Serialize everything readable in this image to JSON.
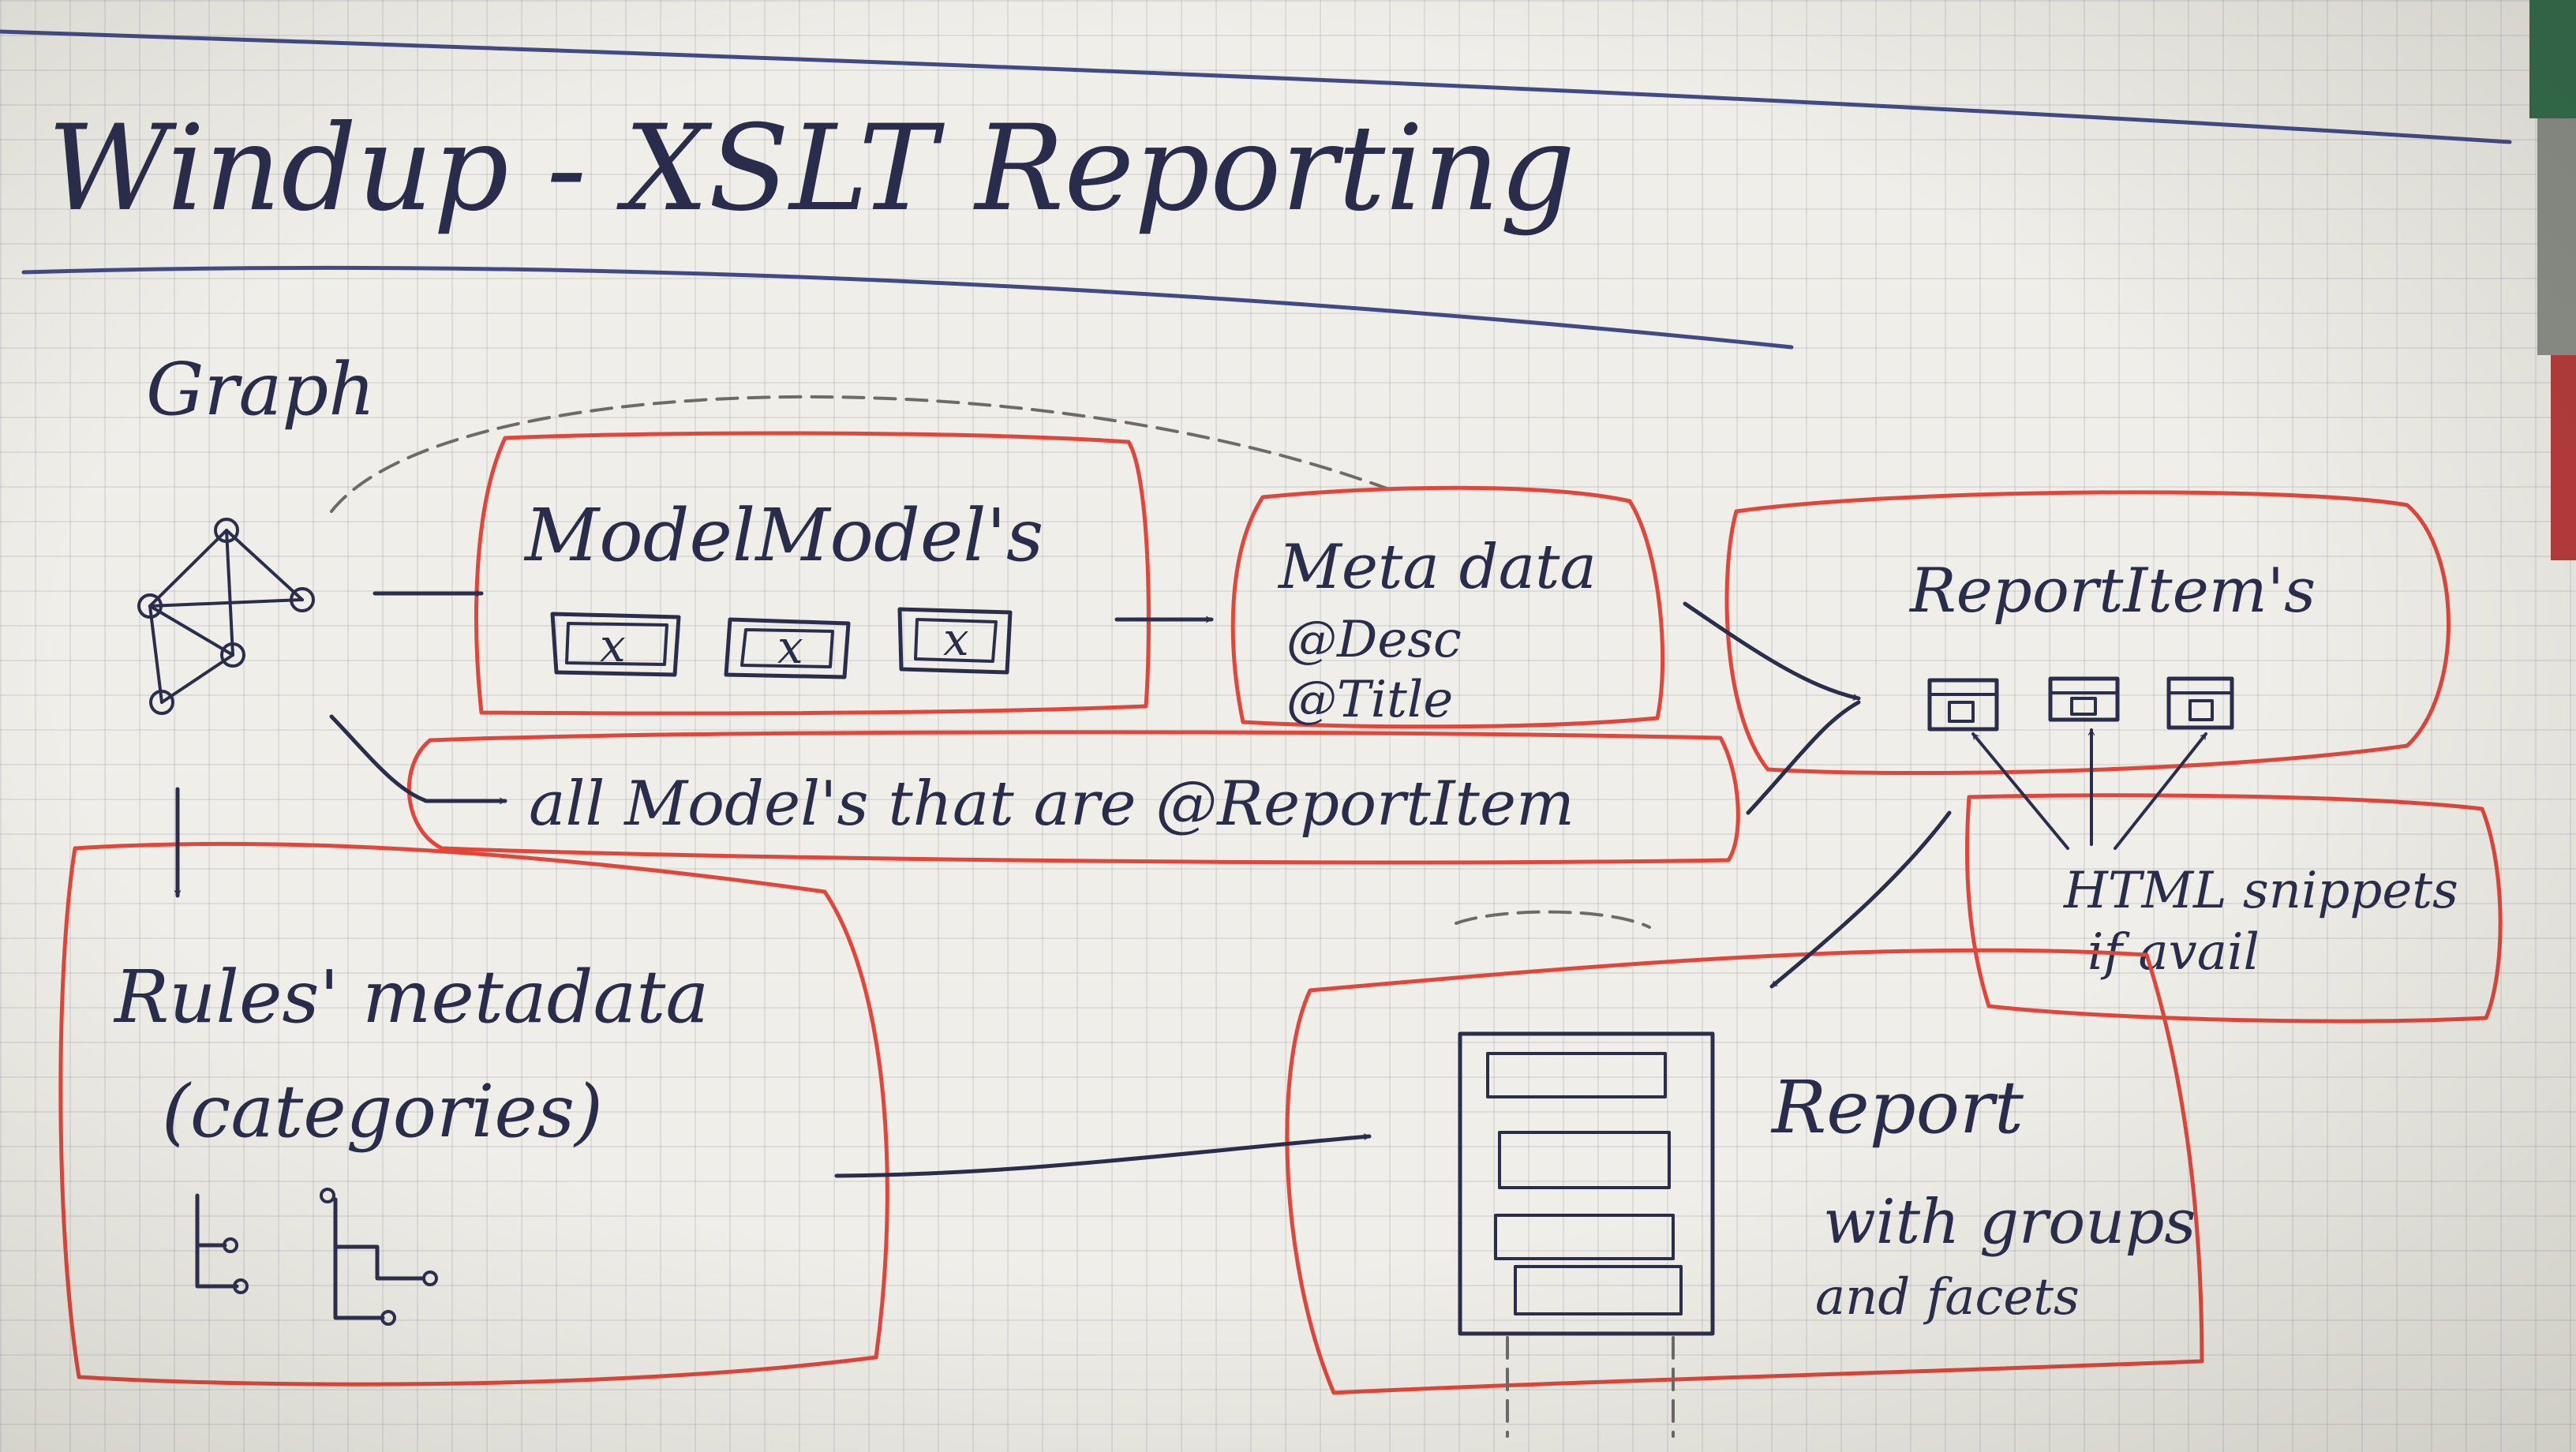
{
  "title": "Windup - XSLT Reporting",
  "graph": {
    "label": "Graph"
  },
  "model": {
    "label": "ModelModel's",
    "icon_mark": "x"
  },
  "metadata": {
    "label": "Meta data",
    "desc": "@Desc",
    "title_attr": "@Title"
  },
  "report_items": {
    "label": "ReportItem's"
  },
  "all_models": {
    "label": "all Model's that are @ReportItem"
  },
  "rules": {
    "label_line1": "Rules' metadata",
    "label_line2": "(categories)"
  },
  "html_snippets": {
    "line1": "HTML snippets",
    "line2": "if avail"
  },
  "report": {
    "label": "Report",
    "line2": "with groups",
    "line3": "and facets"
  },
  "colors": {
    "ink": "#2b2d4d",
    "red_marker": "#e2453a",
    "paper": "#efeee8",
    "pencil": "#6e6a6a"
  }
}
